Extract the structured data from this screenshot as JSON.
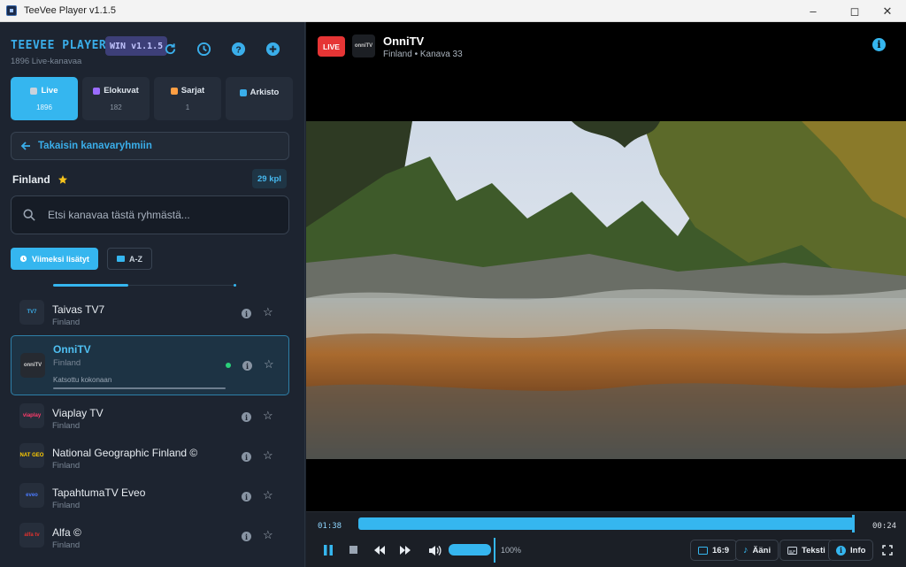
{
  "window": {
    "title": "TeeVee Player v1.1.5"
  },
  "sidebar": {
    "brand": "TEEVEE PLAYER",
    "version": "WIN v1.1.5",
    "subtitle": "1896 Live-kanavaa",
    "tabs": [
      {
        "label": "Live",
        "count": "1896",
        "icon": "tv-icon",
        "color": "#c9d2dc"
      },
      {
        "label": "Elokuvat",
        "count": "182",
        "icon": "film-icon",
        "color": "#9b6cff"
      },
      {
        "label": "Sarjat",
        "count": "1",
        "icon": "popcorn-icon",
        "color": "#ff9f43"
      },
      {
        "label": "Arkisto",
        "count": "",
        "icon": "rewind-icon",
        "color": "#3aaeea"
      }
    ],
    "back_label": "Takaisin kanavaryhmiin",
    "group_name": "Finland",
    "group_count": "29 kpl",
    "search_placeholder": "Etsi kanavaa tästä ryhmästä...",
    "sort_recent": "Viimeksi lisätyt",
    "sort_az": "A-Z",
    "channels": [
      {
        "name": "Taivas TV7",
        "country": "Finland",
        "logo": "TV7",
        "logo_color": "#3aaeea"
      },
      {
        "name": "OnniTV",
        "country": "Finland",
        "logo": "onniTV",
        "logo_color": "#cfcfcf",
        "selected": true,
        "status": "Katsottu kokonaan"
      },
      {
        "name": "Viaplay TV",
        "country": "Finland",
        "logo": "viaplay",
        "logo_color": "#ff3b6b"
      },
      {
        "name": "National Geographic Finland ©",
        "country": "Finland",
        "logo": "NAT GEO",
        "logo_color": "#ffcc00"
      },
      {
        "name": "TapahtumaTV Eveo",
        "country": "Finland",
        "logo": "eveo",
        "logo_color": "#4b7bff"
      },
      {
        "name": "Alfa ©",
        "country": "Finland",
        "logo": "alfa tv",
        "logo_color": "#e0312e"
      }
    ]
  },
  "player": {
    "live_badge": "LIVE",
    "channel_logo": "onniTV",
    "channel_name": "OnniTV",
    "channel_meta": "Finland • Kanava 33",
    "time_current": "01:38",
    "time_end": "00:24",
    "progress": 0.99,
    "volume_percent": "100%",
    "volume": 1.0,
    "buttons": {
      "aspect": "16:9",
      "audio": "Ääni",
      "subtitles": "Teksti",
      "info": "Info"
    }
  },
  "colors": {
    "accent": "#35b6ef",
    "live": "#e63535",
    "online": "#2ad07a"
  }
}
